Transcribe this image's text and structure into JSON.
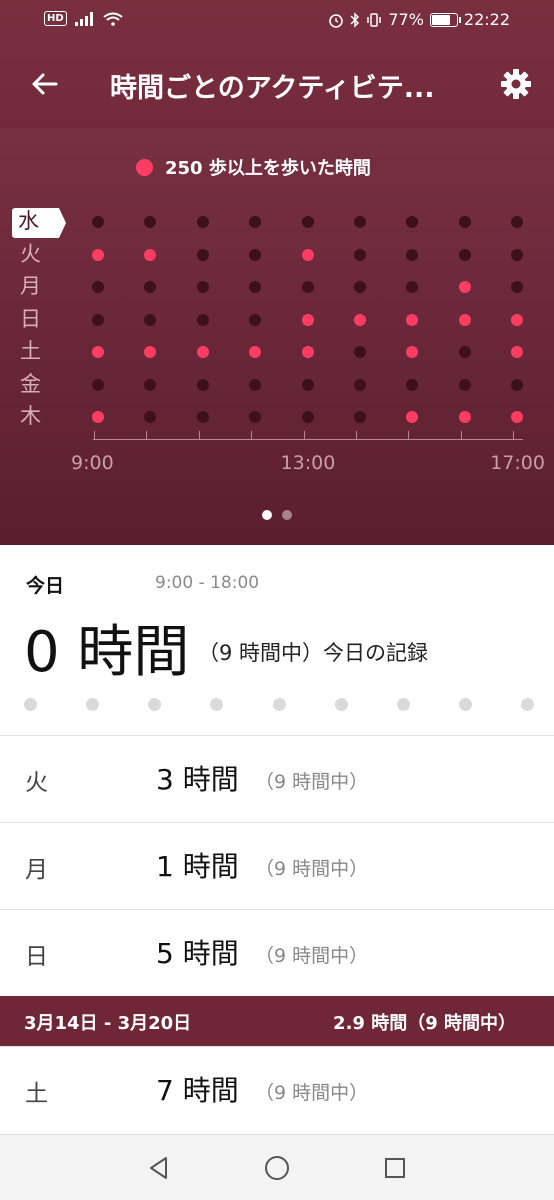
{
  "status_bar": {
    "hd": "HD",
    "battery": "77%",
    "battery_level": 0.77,
    "time": "22:22"
  },
  "appbar": {
    "title": "時間ごとのアクティビテ..."
  },
  "chart_data": {
    "type": "scatter",
    "title": "",
    "legend": "250 歩以上を歩いた時間",
    "days": [
      "水",
      "火",
      "月",
      "日",
      "土",
      "金",
      "木"
    ],
    "selected_day": "水",
    "hours": [
      9,
      10,
      11,
      12,
      13,
      14,
      15,
      16,
      17
    ],
    "x_tick_labels": [
      "9:00",
      "13:00",
      "17:00"
    ],
    "active": [
      [
        0,
        0,
        0,
        0,
        0,
        0,
        0,
        0,
        0
      ],
      [
        1,
        1,
        0,
        0,
        1,
        0,
        0,
        0,
        0
      ],
      [
        0,
        0,
        0,
        0,
        0,
        0,
        0,
        1,
        0
      ],
      [
        0,
        0,
        0,
        0,
        1,
        1,
        1,
        1,
        1
      ],
      [
        1,
        1,
        1,
        1,
        1,
        0,
        1,
        0,
        1
      ],
      [
        0,
        0,
        0,
        0,
        0,
        0,
        0,
        0,
        0
      ],
      [
        1,
        0,
        0,
        0,
        0,
        0,
        1,
        1,
        1
      ]
    ],
    "colors": {
      "active": "#ff3d63",
      "inactive": "#3e1019"
    },
    "pages": 2,
    "current_page": 1
  },
  "today": {
    "label": "今日",
    "range": "9:00 - 18:00",
    "value": "0 時間",
    "sub": "（9 時間中）今日の記録",
    "slots": 9
  },
  "days": [
    {
      "day": "火",
      "value": "3 時間",
      "sub": "（9 時間中）"
    },
    {
      "day": "月",
      "value": "1 時間",
      "sub": "（9 時間中）"
    },
    {
      "day": "日",
      "value": "5 時間",
      "sub": "（9 時間中）"
    }
  ],
  "week": {
    "range": "3月14日 - 3月20日",
    "summary": "2.9 時間（9 時間中）"
  },
  "days_after": [
    {
      "day": "土",
      "value": "7 時間",
      "sub": "（9 時間中）"
    }
  ]
}
